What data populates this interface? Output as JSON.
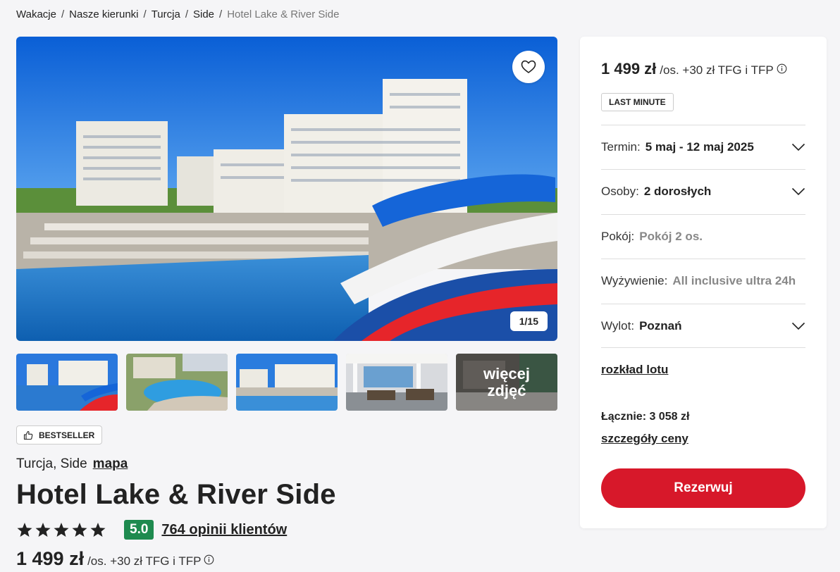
{
  "breadcrumb": {
    "items": [
      "Wakacje",
      "Nasze kierunki",
      "Turcja",
      "Side"
    ],
    "current": "Hotel Lake & River Side",
    "separator": "/"
  },
  "gallery": {
    "counter": "1/15",
    "favorite_icon": "heart-icon",
    "more_label_1": "więcej",
    "more_label_2": "zdjęć"
  },
  "badge": {
    "label": "BESTSELLER",
    "icon": "thumbs-up-icon"
  },
  "location": {
    "text": "Turcja, Side",
    "map_link": "mapa"
  },
  "hotel": {
    "name": "Hotel Lake & River Side",
    "stars": 5,
    "score": "5.0",
    "reviews_link": "764 opinii klientów",
    "price": "1 499 zł",
    "price_suffix": "/os. +30 zł TFG i TFP"
  },
  "booking": {
    "price": "1 499 zł",
    "price_suffix": "/os. +30 zł TFG i TFP",
    "tag": "LAST MINUTE",
    "fields": {
      "termin": {
        "label": "Termin:",
        "value": "5 maj - 12 maj 2025"
      },
      "osoby": {
        "label": "Osoby:",
        "value": "2 dorosłych"
      },
      "pokoj": {
        "label": "Pokój:",
        "value": "Pokój 2 os."
      },
      "wyzywienie": {
        "label": "Wyżywienie:",
        "value": "All inclusive ultra 24h"
      },
      "wylot": {
        "label": "Wylot:",
        "value": "Poznań"
      }
    },
    "flight_link": "rozkład lotu",
    "total": "Łącznie: 3 058 zł",
    "price_details_link": "szczegóły ceny",
    "reserve_button": "Rezerwuj"
  },
  "colors": {
    "accent_red": "#d7182a",
    "score_green": "#1e8a4f",
    "page_bg": "#f5f5f7"
  }
}
